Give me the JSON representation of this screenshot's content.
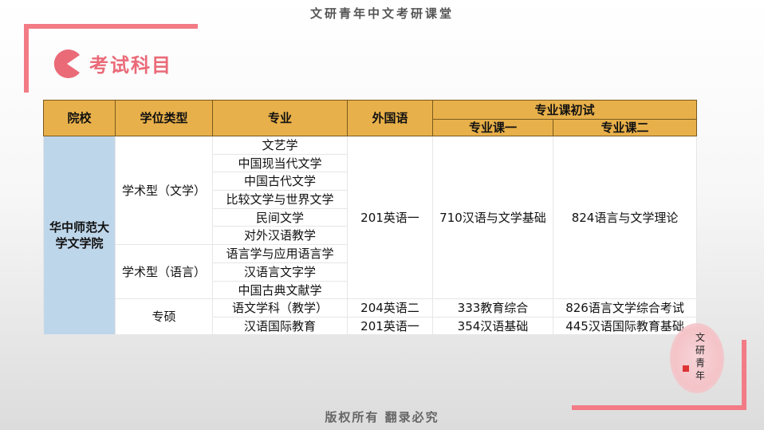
{
  "header": {
    "title": "文研青年中文考研课堂"
  },
  "section": {
    "title": "考试科目"
  },
  "table": {
    "headers": {
      "school": "院校",
      "degree_type": "学位类型",
      "major": "专业",
      "foreign_language": "外国语",
      "prelim": "专业课初试",
      "course1": "专业课一",
      "course2": "专业课二"
    },
    "school": "华中师范大学文学院",
    "degree_types": [
      "学术型（文学）",
      "学术型（语言）",
      "专硕"
    ],
    "majors": [
      "文艺学",
      "中国现当代文学",
      "中国古代文学",
      "比较文学与世界文学",
      "民间文学",
      "对外汉语教学",
      "语言学与应用语言学",
      "汉语言文字学",
      "中国古典文献学",
      "语文学科（教学）",
      "汉语国际教育"
    ],
    "foreign": [
      "201英语一",
      "204英语二",
      "201英语一"
    ],
    "course1": [
      "710汉语与文学基础",
      "333教育综合",
      "354汉语基础"
    ],
    "course2": [
      "824语言与文学理论",
      "826语言文学综合考试",
      "445汉语国际教育基础"
    ]
  },
  "seal": {
    "text": "文研青年"
  },
  "footer": {
    "text": "版权所有  翻录必究"
  }
}
